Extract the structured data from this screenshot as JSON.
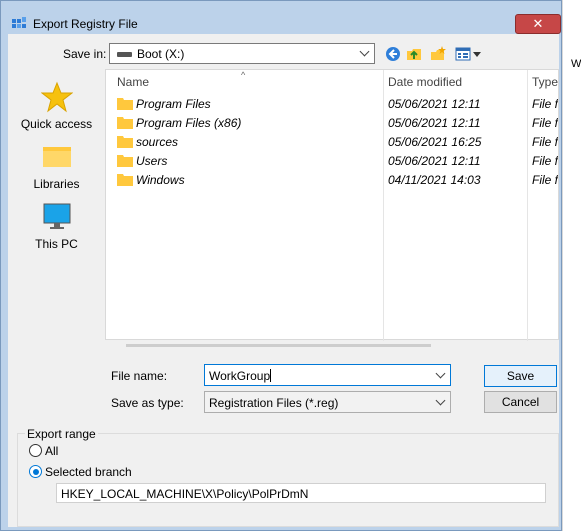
{
  "window": {
    "title": "Export Registry File",
    "close_glyph": "✕",
    "background_text": "W"
  },
  "toolbar": {
    "save_in_label": "Save in:",
    "save_in_value": "Boot (X:)",
    "icons": [
      "drive-icon",
      "back-icon",
      "up-folder-icon",
      "new-folder-icon",
      "views-menu-icon"
    ]
  },
  "places": [
    {
      "label": "Quick access",
      "icon": "star-icon"
    },
    {
      "label": "Libraries",
      "icon": "libraries-icon"
    },
    {
      "label": "This PC",
      "icon": "monitor-icon"
    }
  ],
  "list": {
    "columns": [
      "Name",
      "Date modified",
      "Type"
    ],
    "rows": [
      {
        "name": "Program Files",
        "date": "05/06/2021 12:11",
        "type": "File folder"
      },
      {
        "name": "Program Files (x86)",
        "date": "05/06/2021 12:11",
        "type": "File folder"
      },
      {
        "name": "sources",
        "date": "05/06/2021 16:25",
        "type": "File folder"
      },
      {
        "name": "Users",
        "date": "05/06/2021 12:11",
        "type": "File folder"
      },
      {
        "name": "Windows",
        "date": "04/11/2021 14:03",
        "type": "File folder"
      }
    ]
  },
  "form": {
    "file_name_label": "File name:",
    "file_name_value": "WorkGroup",
    "save_as_type_label": "Save as type:",
    "save_as_type_value": "Registration Files (*.reg)",
    "save_button": "Save",
    "cancel_button": "Cancel"
  },
  "export_range": {
    "legend": "Export range",
    "all_label": "All",
    "selected_label": "Selected branch",
    "selected": "Selected branch",
    "branch_value": "HKEY_LOCAL_MACHINE\\X\\Policy\\PolPrDmN"
  },
  "colors": {
    "title_bar": "#bcd2ea",
    "close_button": "#c64747",
    "focus_accent": "#0078d7",
    "folder": "#ffc83d"
  }
}
